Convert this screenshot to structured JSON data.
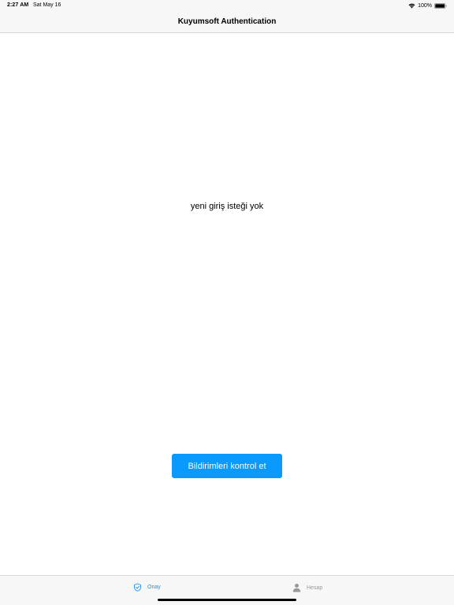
{
  "status_bar": {
    "time": "2:27 AM",
    "date": "Sat May 16",
    "battery": "100%"
  },
  "nav": {
    "title": "Kuyumsoft Authentication"
  },
  "main": {
    "empty_message": "yeni giriş isteği yok",
    "check_button_label": "Bildirimleri kontrol et"
  },
  "tabs": [
    {
      "label": "Onay",
      "icon": "shield-check-icon",
      "selected": true
    },
    {
      "label": "Hesap",
      "icon": "person-icon",
      "selected": false
    }
  ],
  "colors": {
    "accent": "#0a99fc",
    "tab_active": "#1a8cf0",
    "tab_inactive": "#999999",
    "bar_background": "#f7f7f7"
  }
}
